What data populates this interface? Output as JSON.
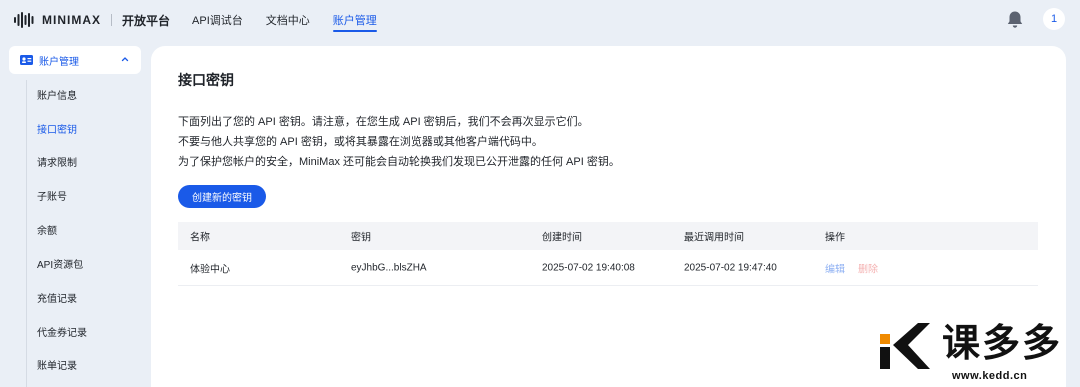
{
  "header": {
    "logo_text": "MINIMAX",
    "logo_sub": "开放平台",
    "nav": [
      {
        "label": "API调试台",
        "active": false
      },
      {
        "label": "文档中心",
        "active": false
      },
      {
        "label": "账户管理",
        "active": true
      }
    ],
    "avatar_text": "1",
    "bell_icon": "bell-icon"
  },
  "sidebar": {
    "group_label": "账户管理",
    "group_icon": "id-card-icon",
    "items": [
      {
        "label": "账户信息",
        "active": false
      },
      {
        "label": "接口密钥",
        "active": true
      },
      {
        "label": "请求限制",
        "active": false
      },
      {
        "label": "子账号",
        "active": false
      },
      {
        "label": "余额",
        "active": false
      },
      {
        "label": "API资源包",
        "active": false
      },
      {
        "label": "充值记录",
        "active": false
      },
      {
        "label": "代金券记录",
        "active": false
      },
      {
        "label": "账单记录",
        "active": false
      }
    ]
  },
  "main": {
    "title": "接口密钥",
    "description": [
      "下面列出了您的 API 密钥。请注意，在您生成 API 密钥后，我们不会再次显示它们。",
      "不要与他人共享您的 API 密钥，或将其暴露在浏览器或其他客户端代码中。",
      "为了保护您帐户的安全，MiniMax 还可能会自动轮换我们发现已公开泄露的任何 API 密钥。"
    ],
    "create_button": "创建新的密钥",
    "table": {
      "headers": [
        "名称",
        "密钥",
        "创建时间",
        "最近调用时间",
        "操作"
      ],
      "rows": [
        {
          "name": "体验中心",
          "key": "eyJhbG...blsZHA",
          "created": "2025-07-02 19:40:08",
          "last_used": "2025-07-02 19:47:40",
          "edit": "编辑",
          "delete": "删除"
        }
      ]
    }
  },
  "watermark": {
    "text": "课多多",
    "url": "www.kedd.cn"
  },
  "colors": {
    "accent": "#1a5ae8",
    "background": "#eaeff6",
    "danger_link": "#f4b2b2"
  }
}
